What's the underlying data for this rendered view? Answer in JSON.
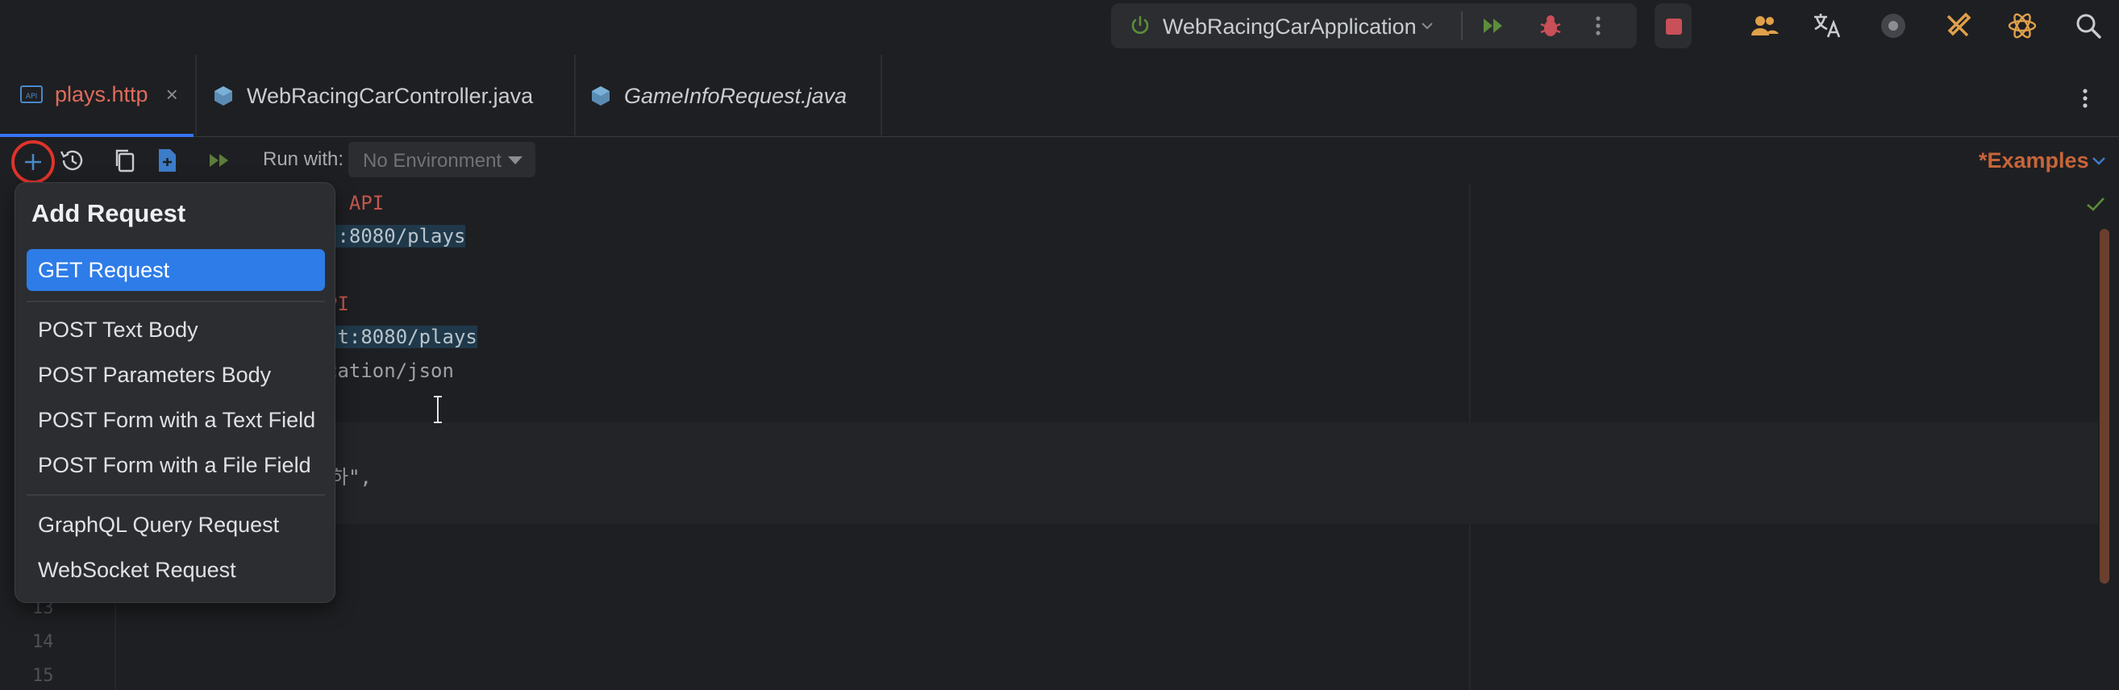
{
  "run_config": {
    "name": "WebRacingCarApplication",
    "colors": {
      "run": "#5c8d3a",
      "debug": "#c94f58",
      "stop": "#c94f58"
    }
  },
  "tabs": [
    {
      "label": "plays.http",
      "icon": "api-file-icon",
      "active": true,
      "closable": true
    },
    {
      "label": "WebRacingCarController.java",
      "icon": "java-class-icon",
      "active": false
    },
    {
      "label": "GameInfoRequest.java",
      "icon": "java-class-icon",
      "active": false,
      "italic": true
    }
  ],
  "toolbar": {
    "run_with_label": "Run with:",
    "environment": "No Environment",
    "examples_label": "*Examples"
  },
  "editor": {
    "lines": [
      {
        "text": "| API",
        "style": "kw-red"
      },
      {
        "text": "t:8080/plays",
        "style": "url"
      },
      {
        "text": "PI",
        "style": "kw-red"
      },
      {
        "text": "st:8080/plays",
        "style": "url"
      },
      {
        "text": "cation/json",
        "style": "gray"
      },
      {
        "text": "하\",",
        "style": "gray"
      }
    ],
    "line_numbers": [
      "13",
      "14",
      "15"
    ]
  },
  "add_request_menu": {
    "title": "Add Request",
    "items": [
      "GET Request",
      "POST Text Body",
      "POST Parameters Body",
      "POST Form with a Text Field",
      "POST Form with a File Field",
      "GraphQL Query Request",
      "WebSocket Request"
    ],
    "selected_index": 0
  },
  "accent_colors": {
    "selection": "#2e7ce8",
    "highlight_ring": "#e0332b",
    "examples": "#c6653a"
  }
}
